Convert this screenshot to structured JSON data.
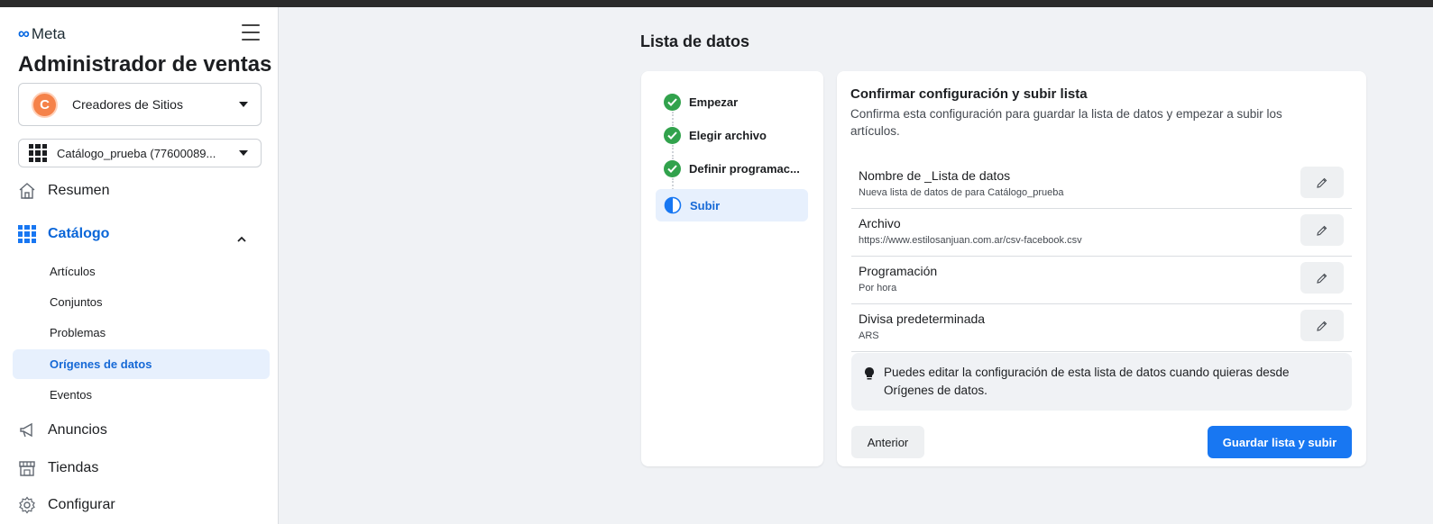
{
  "app": {
    "brand": "Meta",
    "title": "Administrador de ventas"
  },
  "sidebar": {
    "business": {
      "initial": "C",
      "name": "Creadores de Sitios"
    },
    "catalog_selector": {
      "name": "Catálogo_prueba (77600089..."
    },
    "nav": {
      "summary": "Resumen",
      "catalog": "Catálogo",
      "catalog_sub": [
        "Artículos",
        "Conjuntos",
        "Problemas",
        "Orígenes de datos",
        "Eventos"
      ],
      "ads": "Anuncios",
      "shops": "Tiendas",
      "settings": "Configurar"
    },
    "active_sub": "Orígenes de datos"
  },
  "page": {
    "title": "Lista de datos"
  },
  "steps": [
    {
      "label": "Empezar",
      "status": "done"
    },
    {
      "label": "Elegir archivo",
      "status": "done"
    },
    {
      "label": "Definir programac...",
      "status": "done"
    },
    {
      "label": "Subir",
      "status": "current"
    }
  ],
  "confirm": {
    "title": "Confirmar configuración y subir lista",
    "description": "Confirma esta configuración para guardar la lista de datos y empezar a subir los artículos.",
    "rows": [
      {
        "label": "Nombre de _Lista de datos",
        "value": "Nueva lista de datos de para Catálogo_prueba"
      },
      {
        "label": "Archivo",
        "value": "https://www.estilosanjuan.com.ar/csv-facebook.csv"
      },
      {
        "label": "Programación",
        "value": "Por hora"
      },
      {
        "label": "Divisa predeterminada",
        "value": "ARS"
      }
    ],
    "tip": "Puedes editar la configuración de esta lista de datos cuando quieras desde Orígenes de datos.",
    "back_button": "Anterior",
    "save_button": "Guardar lista y subir"
  },
  "colors": {
    "accent": "#1877f2",
    "success": "#31a24c",
    "active_bg": "#e7f0fd",
    "avatar": "#f5824a"
  }
}
